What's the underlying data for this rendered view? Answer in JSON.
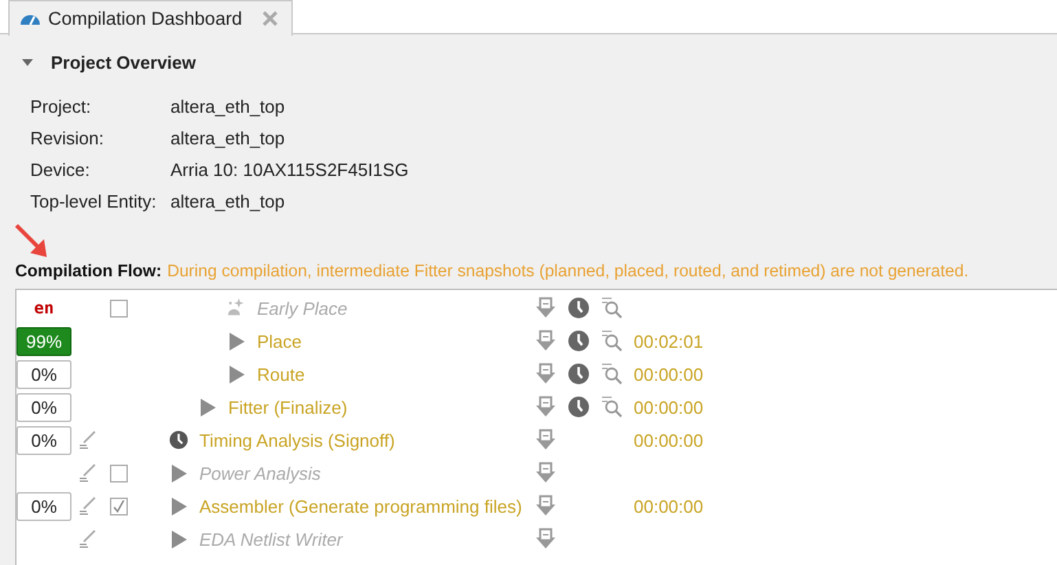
{
  "tab": {
    "title": "Compilation Dashboard",
    "selected": true
  },
  "overview": {
    "title": "Project Overview",
    "expanded": true,
    "fields": [
      {
        "label": "Project:",
        "value": "altera_eth_top"
      },
      {
        "label": "Revision:",
        "value": "altera_eth_top"
      },
      {
        "label": "Device:",
        "value": "Arria 10: 10AX115S2F45I1SG"
      },
      {
        "label": "Top-level Entity:",
        "value": "altera_eth_top"
      }
    ]
  },
  "flow": {
    "title": "Compilation Flow:",
    "message": "During compilation, intermediate Fitter snapshots (planned, placed, routed, and retimed) are not generated.",
    "steps": [
      {
        "children": [
          {
            "children": [
              {
                "label": "Early Place",
                "kind": "sparkle",
                "disabled": true,
                "progress": {
                  "text": "en",
                  "kind": "status"
                },
                "checkbox": {
                  "checked": false
                },
                "settings": false,
                "timing_tools": true
              },
              {
                "label": "Place",
                "kind": "arrow",
                "disabled": false,
                "progress": {
                  "text": "99%",
                  "kind": "running"
                },
                "settings": false,
                "timing_tools": true,
                "time": "00:02:01"
              },
              {
                "label": "Route",
                "kind": "arrow",
                "disabled": false,
                "progress": {
                  "text": "0%",
                  "kind": "idle"
                },
                "settings": false,
                "timing_tools": true,
                "time": "00:00:00"
              }
            ]
          },
          {
            "label": "Fitter (Finalize)",
            "kind": "arrow",
            "disabled": false,
            "progress": {
              "text": "0%",
              "kind": "idle"
            },
            "settings": false,
            "timing_tools": true,
            "time": "00:00:00"
          }
        ]
      },
      {
        "label": "Timing Analysis (Signoff)",
        "kind": "clock",
        "disabled": false,
        "progress": {
          "text": "0%",
          "kind": "idle"
        },
        "settings": true,
        "timing_tools": false,
        "time": "00:00:00"
      },
      {
        "label": "Power Analysis",
        "kind": "arrow",
        "disabled": true,
        "settings": true,
        "checkbox": {
          "checked": false
        },
        "timing_tools": false
      },
      {
        "label": "Assembler (Generate programming files)",
        "kind": "arrow",
        "disabled": false,
        "progress": {
          "text": "0%",
          "kind": "idle"
        },
        "settings": true,
        "checkbox": {
          "checked": true
        },
        "timing_tools": false,
        "time": "00:00:00"
      },
      {
        "label": "EDA Netlist Writer",
        "kind": "arrow",
        "disabled": true,
        "settings": true,
        "timing_tools": false
      }
    ]
  }
}
